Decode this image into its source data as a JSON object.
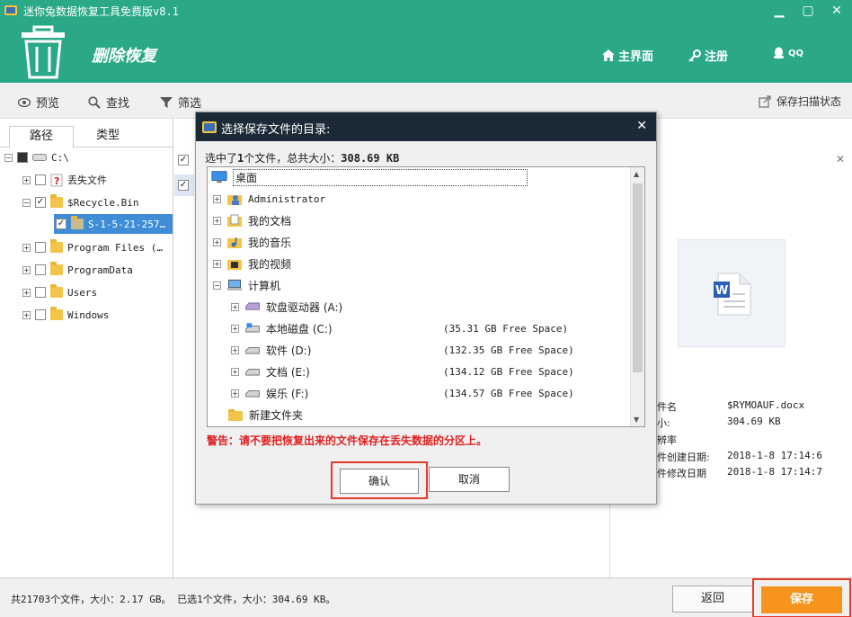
{
  "window": {
    "title": "迷你兔数据恢复工具免费版v8.1",
    "minimize": "▁",
    "maximize": "▢",
    "close": "✕"
  },
  "header": {
    "brand": "删除恢复",
    "home_label": "主界面",
    "register_label": "注册",
    "qq_label": "QQ",
    "bg_color": "#2aa887"
  },
  "toolbar": {
    "preview_label": "预览",
    "search_label": "查找",
    "filter_label": "筛选",
    "save_scan_label": "保存扫描状态"
  },
  "left_tabs": {
    "path_label": "路径",
    "type_label": "类型"
  },
  "tree": {
    "root": "C:\\",
    "items": [
      {
        "label": "丢失文件"
      },
      {
        "label": "$Recycle.Bin"
      },
      {
        "label": "S-1-5-21-257…"
      },
      {
        "label": "Program Files (…"
      },
      {
        "label": "ProgramData"
      },
      {
        "label": "Users"
      },
      {
        "label": "Windows"
      }
    ]
  },
  "dialog": {
    "title": "选择保存文件的目录:",
    "close": "✕",
    "summary_prefix": "选中了",
    "summary_count": "1",
    "summary_mid": "个文件，总共大小：",
    "summary_size": "308.69 KB",
    "tree": [
      {
        "label": "桌面"
      },
      {
        "label": "Administrator"
      },
      {
        "label": "我的文档"
      },
      {
        "label": "我的音乐"
      },
      {
        "label": "我的视频"
      },
      {
        "label": "计算机"
      },
      {
        "label": "软盘驱动器 (A:)",
        "space": ""
      },
      {
        "label": "本地磁盘 (C:)",
        "space": "(35.31 GB Free Space)"
      },
      {
        "label": "软件 (D:)",
        "space": "(132.35 GB Free Space)"
      },
      {
        "label": "文档 (E:)",
        "space": "(134.12 GB Free Space)"
      },
      {
        "label": "娱乐 (F:)",
        "space": "(134.57 GB Free Space)"
      },
      {
        "label": "新建文件夹"
      }
    ],
    "warning": "警告：请不要把恢复出来的文件保存在丢失数据的分区上。",
    "confirm_label": "确认",
    "cancel_label": "取消"
  },
  "file_info": {
    "rows": [
      {
        "label": "件名",
        "value": "$RYMOAUF.docx"
      },
      {
        "label": "小:",
        "value": "304.69 KB"
      },
      {
        "label": "辨率",
        "value": ""
      },
      {
        "label": "件创建日期:",
        "value": "2018-1-8 17:14:6"
      },
      {
        "label": "件修改日期",
        "value": "2018-1-8 17:14:7"
      }
    ],
    "close": "✕"
  },
  "status": {
    "text": "共21703个文件，大小：2.17 GB。 已选1个文件，大小：304.69 KB。",
    "back_label": "返回",
    "save_label": "保存"
  }
}
